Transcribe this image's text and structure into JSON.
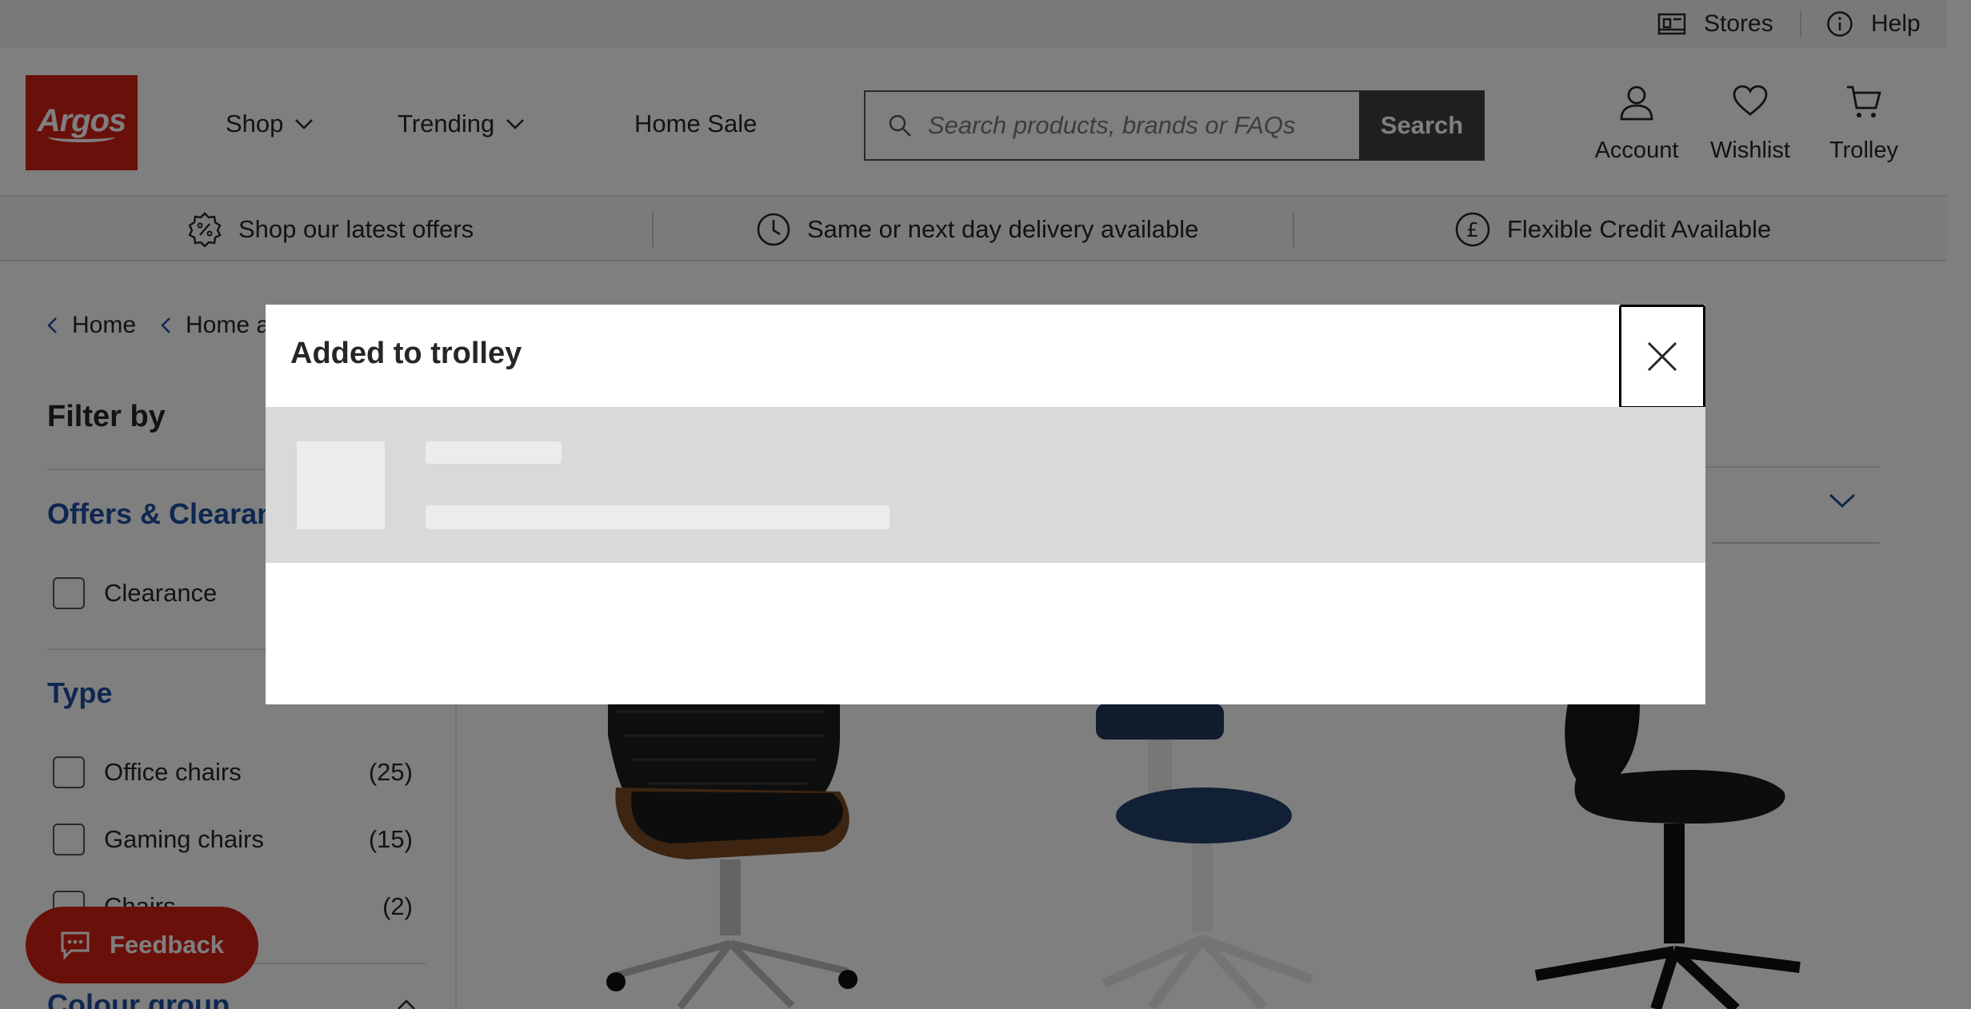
{
  "utility": {
    "stores": "Stores",
    "help": "Help"
  },
  "header": {
    "logo": "Argos",
    "nav": [
      "Shop",
      "Trending",
      "Home Sale"
    ],
    "search": {
      "placeholder": "Search products, brands or FAQs",
      "button": "Search"
    },
    "actions": {
      "account": "Account",
      "wishlist": "Wishlist",
      "trolley": "Trolley"
    }
  },
  "benefits": [
    "Shop our latest offers",
    "Same or next day delivery available",
    "Flexible Credit Available"
  ],
  "breadcrumb": [
    "Home",
    "Home a"
  ],
  "filters": {
    "title": "Filter by",
    "offers": {
      "heading": "Offers & Clearan",
      "options": [
        {
          "label": "Clearance",
          "count": ""
        }
      ]
    },
    "type": {
      "heading": "Type",
      "options": [
        {
          "label": "Office chairs",
          "count": "(25)"
        },
        {
          "label": "Gaming chairs",
          "count": "(15)"
        },
        {
          "label": "Chairs",
          "count": "(2)"
        }
      ]
    },
    "colour": {
      "heading": "Colour group"
    }
  },
  "feedback": "Feedback",
  "modal": {
    "title": "Added to trolley"
  },
  "colors": {
    "brand_red": "#d42114",
    "link_blue": "#1f4fa0",
    "search_button": "#404040",
    "overlay": "rgba(0,0,0,0.5)"
  },
  "icons": [
    "store-icon",
    "info-icon",
    "chevron-down-icon",
    "search-icon",
    "account-icon",
    "heart-icon",
    "trolley-icon",
    "offers-badge-icon",
    "clock-icon",
    "pound-icon",
    "chevron-left-icon",
    "chat-icon",
    "close-icon"
  ]
}
